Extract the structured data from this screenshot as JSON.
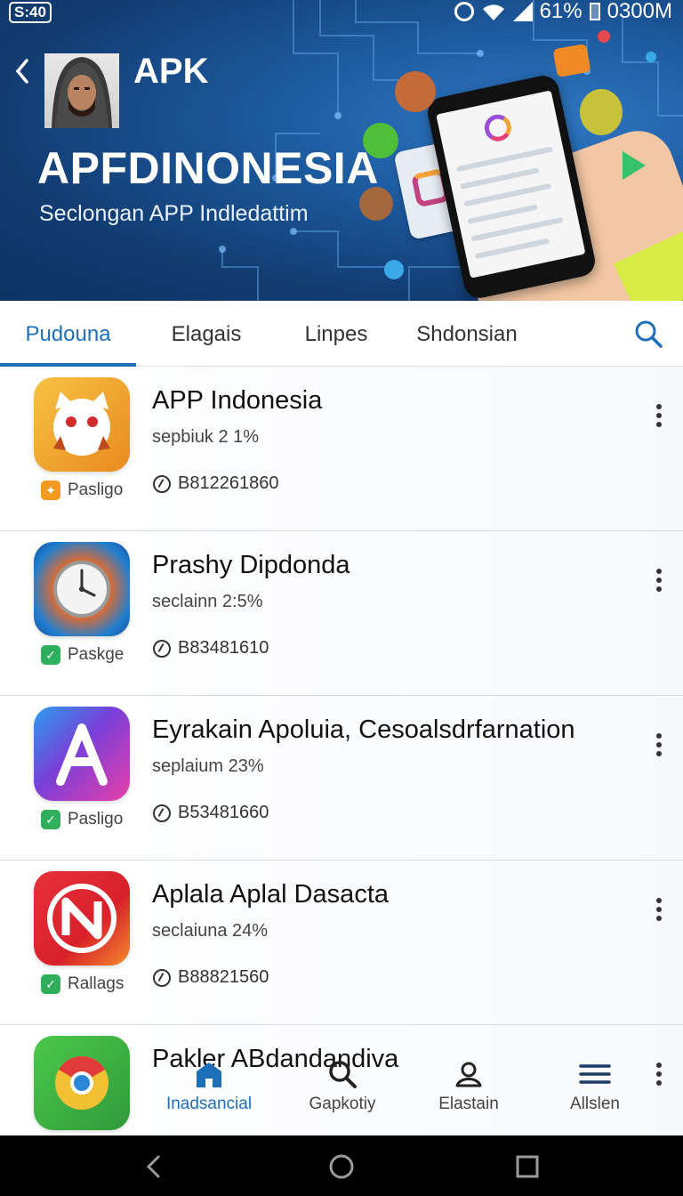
{
  "status_bar": {
    "time": "S:40",
    "battery": "61%",
    "speed": "0300M"
  },
  "header": {
    "brand_small": "APK",
    "brand_big": "APFDINONESIA",
    "subtitle": "Seclongan APP Indledattim"
  },
  "tabs": [
    {
      "label": "Pudouna",
      "active": true
    },
    {
      "label": "Elagais",
      "active": false
    },
    {
      "label": "Linpes",
      "active": false
    },
    {
      "label": "Shdonsian",
      "active": false
    }
  ],
  "apps": [
    {
      "title": "APP Indonesia",
      "sub": "sepbiuk 2 1%",
      "code": "B812261860",
      "badge": "Pasligo",
      "icon": "cat-face-icon",
      "badge_color": "#f29a1f"
    },
    {
      "title": "Prashy Dipdonda",
      "sub": "seclainn 2:5%",
      "code": "B83481610",
      "badge": "Paskge",
      "icon": "clock-icon",
      "badge_color": "#2fae5b"
    },
    {
      "title": "Eyrakain Apoluia, Cesoalsdrfarnation",
      "sub": "seplaium 23%",
      "code": "B53481660",
      "badge": "Pasligo",
      "icon": "letter-a-icon",
      "badge_color": "#2fae5b"
    },
    {
      "title": "Aplala Aplal Dasacta",
      "sub": "seclaiuna 24%",
      "code": "B88821560",
      "badge": "Rallags",
      "icon": "letter-n-icon",
      "badge_color": "#2fae5b"
    },
    {
      "title": "Pakler ABdandandiva",
      "sub": "",
      "code": "",
      "badge": "",
      "icon": "browser-icon",
      "badge_color": "#2fae5b"
    }
  ],
  "bottom_nav": [
    {
      "label": "Inadsancial",
      "icon": "home-icon",
      "active": true
    },
    {
      "label": "Gapkotiy",
      "icon": "search-icon",
      "active": false
    },
    {
      "label": "Elastain",
      "icon": "user-icon",
      "active": false
    },
    {
      "label": "Allslen",
      "icon": "menu-icon",
      "active": false
    }
  ],
  "colors": {
    "accent": "#1d6fb8",
    "header_dark": "#123d73"
  }
}
